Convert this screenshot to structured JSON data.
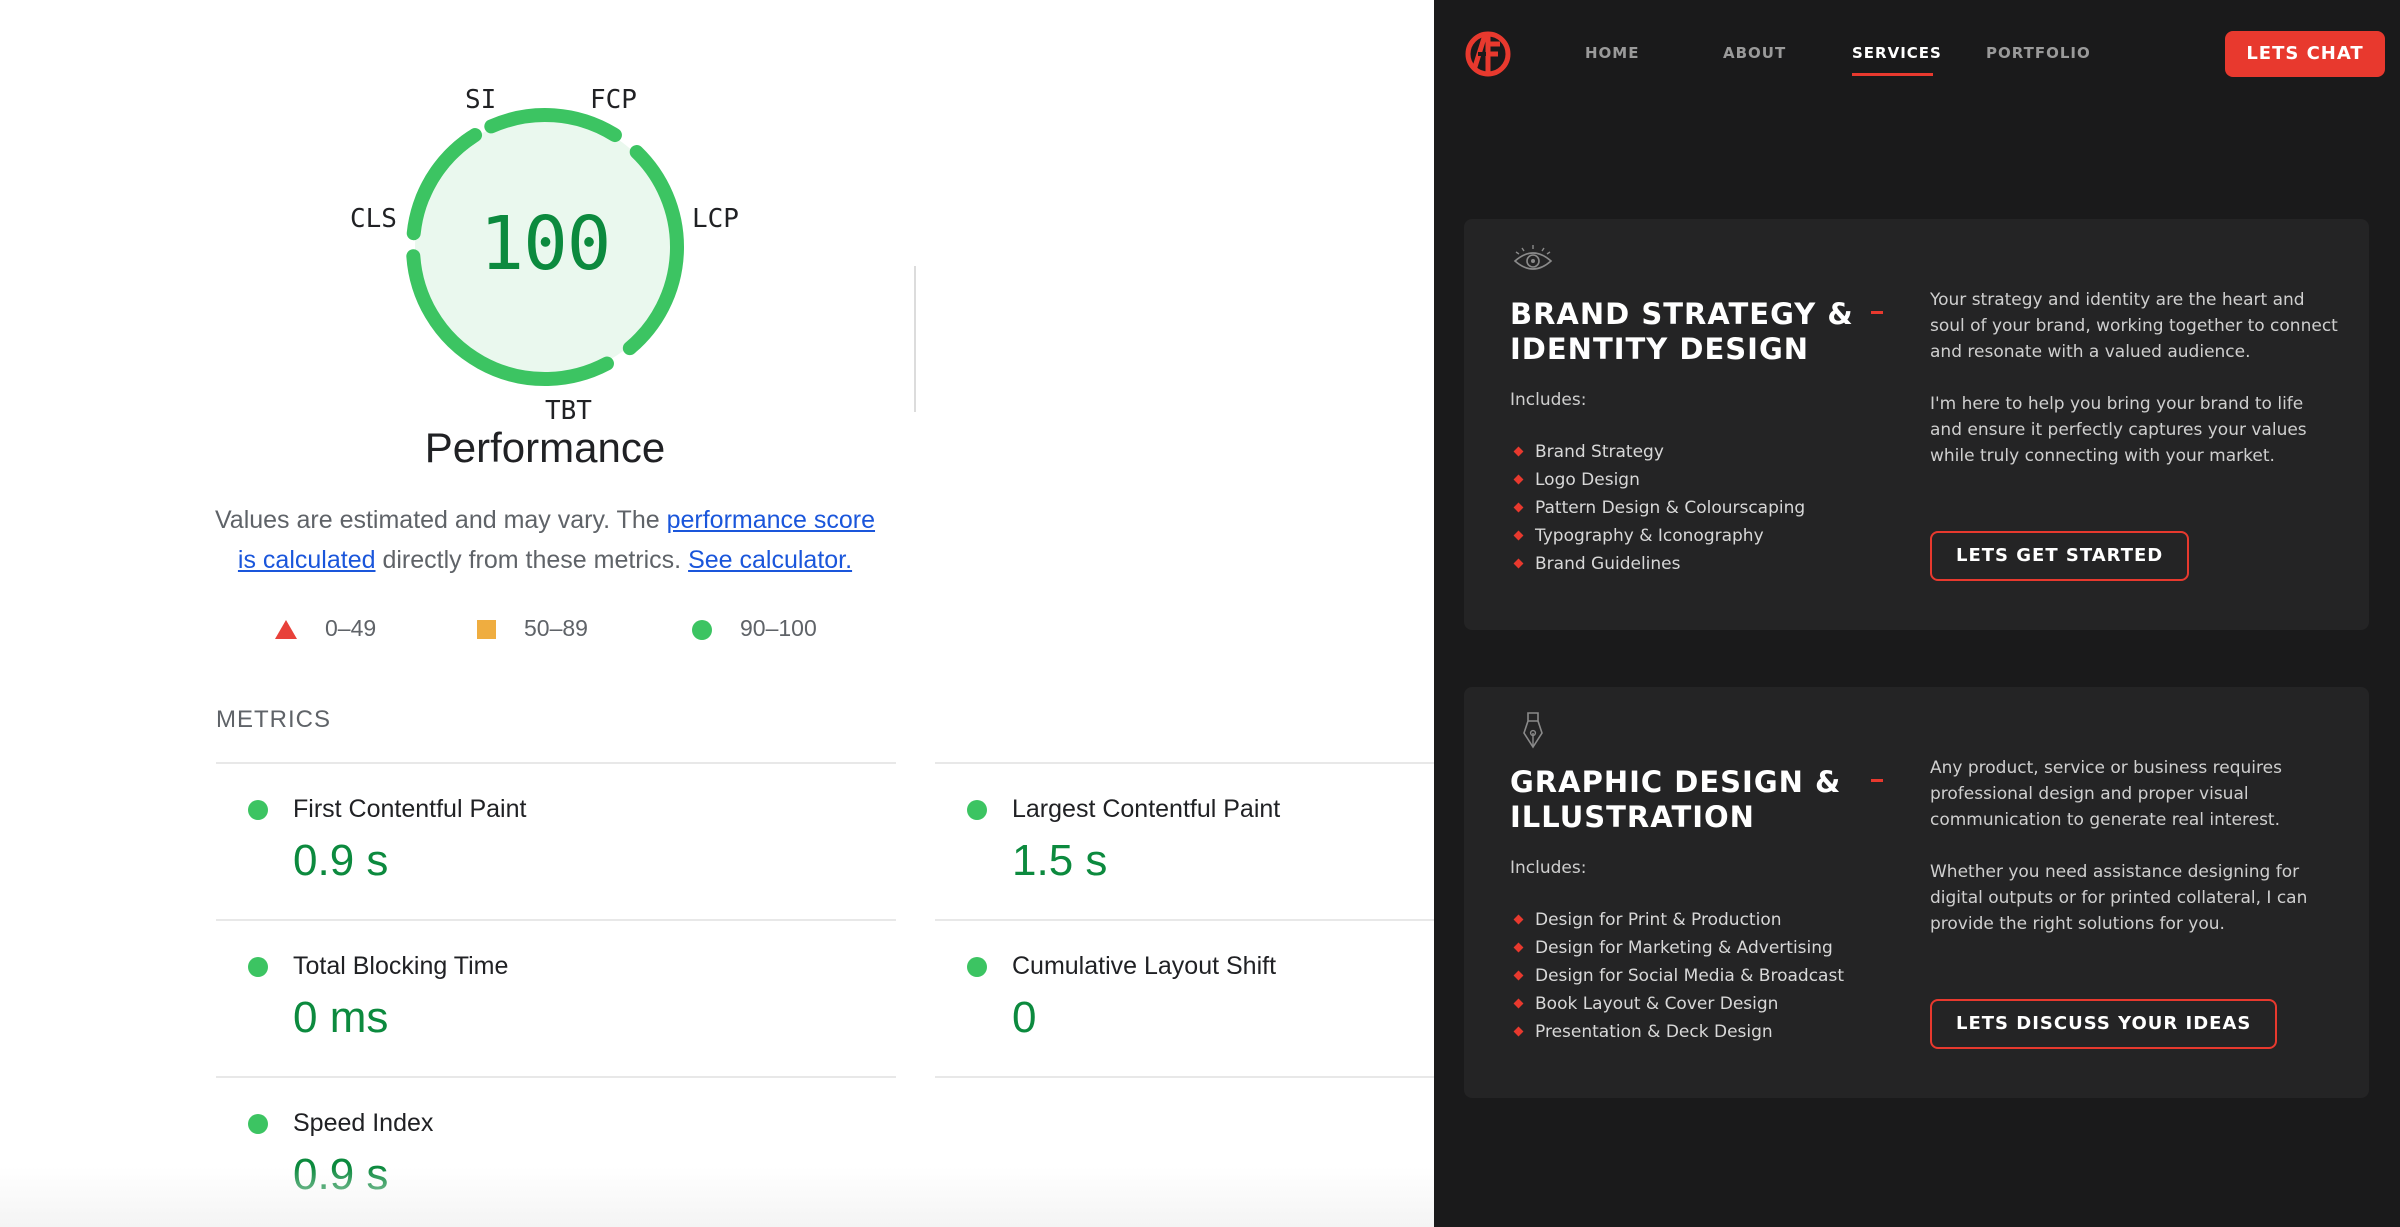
{
  "lighthouse": {
    "score": "100",
    "gauge_labels": {
      "si": "SI",
      "fcp": "FCP",
      "cls": "CLS",
      "lcp": "LCP",
      "tbt": "TBT"
    },
    "category_title": "Performance",
    "description_prefix": "Values are estimated and may vary. The ",
    "description_link1": "performance score is calculated",
    "description_middle": " directly from these metrics. ",
    "description_link2": "See calculator.",
    "legend": [
      {
        "shape": "triangle",
        "range": "0–49",
        "color": "#e8413a"
      },
      {
        "shape": "square",
        "range": "50–89",
        "color": "#efad40"
      },
      {
        "shape": "circle",
        "range": "90–100",
        "color": "#3cc462"
      }
    ],
    "metrics_header": "METRICS",
    "metrics": [
      {
        "name": "First Contentful Paint",
        "value": "0.9 s"
      },
      {
        "name": "Largest Contentful Paint",
        "value": "1.5 s"
      },
      {
        "name": "Total Blocking Time",
        "value": "0 ms"
      },
      {
        "name": "Cumulative Layout Shift",
        "value": "0"
      },
      {
        "name": "Speed Index",
        "value": "0.9 s"
      }
    ],
    "colors": {
      "pass": "#0c8a3e",
      "pass_ring": "#3cc462",
      "link": "#1a56db"
    }
  },
  "site": {
    "logo_icon": "ae-monogram-logo",
    "nav": [
      {
        "label": "HOME",
        "active": false
      },
      {
        "label": "ABOUT",
        "active": false
      },
      {
        "label": "SERVICES",
        "active": true
      },
      {
        "label": "PORTFOLIO",
        "active": false
      }
    ],
    "chat_button": "LETS CHAT",
    "accent_color": "#e8392e",
    "services": [
      {
        "icon": "eye-icon",
        "title_line1": "BRAND STRATEGY &",
        "title_line2": "IDENTITY DESIGN",
        "includes_label": "Includes:",
        "items": [
          "Brand Strategy",
          "Logo Design",
          "Pattern Design & Colourscaping",
          "Typography & Iconography",
          "Brand Guidelines"
        ],
        "para1": "Your strategy and identity are the heart and soul of your brand, working together to connect and resonate with a valued audience.",
        "para2": "I'm here to help you bring your brand to life and ensure it perfectly captures your values while truly connecting with your market.",
        "cta": "LETS GET STARTED"
      },
      {
        "icon": "pen-nib-icon",
        "title_line1": "GRAPHIC DESIGN &",
        "title_line2": "ILLUSTRATION",
        "includes_label": "Includes:",
        "items": [
          "Design for Print & Production",
          "Design for Marketing & Advertising",
          "Design for Social Media & Broadcast",
          "Book Layout & Cover Design",
          "Presentation & Deck Design"
        ],
        "para1": "Any product, service or business requires professional design and proper visual communication to generate real interest.",
        "para2": "Whether you need assistance designing for digital outputs or for printed collateral, I can provide the right solutions for you.",
        "cta": "LETS DISCUSS YOUR IDEAS"
      }
    ]
  }
}
